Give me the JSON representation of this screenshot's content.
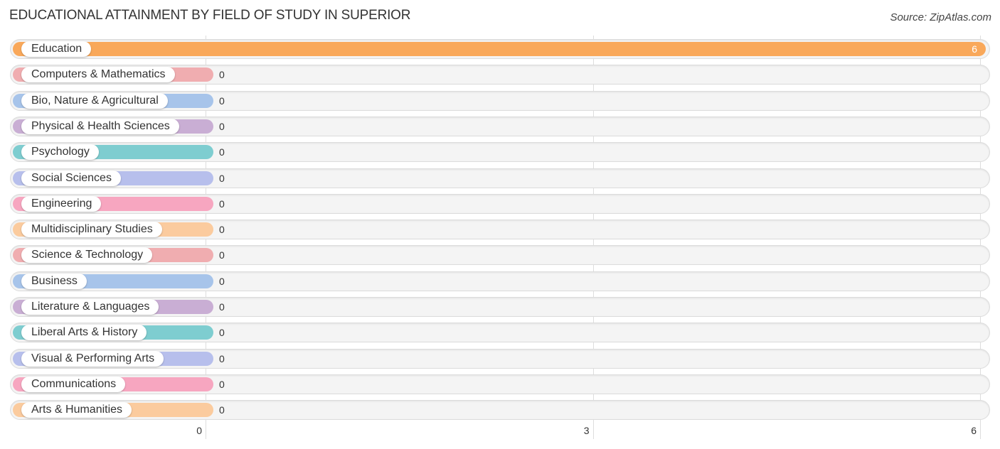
{
  "title": "EDUCATIONAL ATTAINMENT BY FIELD OF STUDY IN SUPERIOR",
  "source": "Source: ZipAtlas.com",
  "chart_data": {
    "type": "bar",
    "orientation": "horizontal",
    "title": "EDUCATIONAL ATTAINMENT BY FIELD OF STUDY IN SUPERIOR",
    "xlabel": "",
    "ylabel": "",
    "xlim": [
      0,
      6
    ],
    "xticks": [
      "0",
      "3",
      "6"
    ],
    "grid": true,
    "categories": [
      "Education",
      "Computers & Mathematics",
      "Bio, Nature & Agricultural",
      "Physical & Health Sciences",
      "Psychology",
      "Social Sciences",
      "Engineering",
      "Multidisciplinary Studies",
      "Science & Technology",
      "Business",
      "Literature & Languages",
      "Liberal Arts & History",
      "Visual & Performing Arts",
      "Communications",
      "Arts & Humanities"
    ],
    "values": [
      6,
      0,
      0,
      0,
      0,
      0,
      0,
      0,
      0,
      0,
      0,
      0,
      0,
      0,
      0
    ],
    "value_labels": [
      "6",
      "0",
      "0",
      "0",
      "0",
      "0",
      "0",
      "0",
      "0",
      "0",
      "0",
      "0",
      "0",
      "0",
      "0"
    ],
    "colors": [
      "#f9a85a",
      "#f0adb0",
      "#a7c4ea",
      "#c9aed4",
      "#7ecdd0",
      "#b7bfec",
      "#f7a6c0",
      "#fbcb9e",
      "#f0adb0",
      "#a7c4ea",
      "#c9aed4",
      "#7ecdd0",
      "#b7bfec",
      "#f7a6c0",
      "#fbcb9e"
    ]
  }
}
